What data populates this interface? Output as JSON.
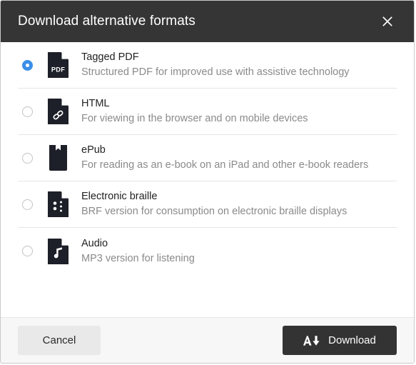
{
  "dialog": {
    "title": "Download alternative formats",
    "close_icon": "close-icon"
  },
  "formats": [
    {
      "id": "tagged-pdf",
      "title": "Tagged PDF",
      "description": "Structured PDF for improved use with assistive technology",
      "icon": "pdf-file-icon",
      "icon_label": "PDF",
      "selected": true
    },
    {
      "id": "html",
      "title": "HTML",
      "description": "For viewing in the browser and on mobile devices",
      "icon": "html-link-file-icon",
      "selected": false
    },
    {
      "id": "epub",
      "title": "ePub",
      "description": "For reading as an e-book on an iPad and other e-book readers",
      "icon": "epub-book-icon",
      "selected": false
    },
    {
      "id": "electronic-braille",
      "title": "Electronic braille",
      "description": "BRF version for consumption on electronic braille displays",
      "icon": "braille-file-icon",
      "selected": false
    },
    {
      "id": "audio",
      "title": "Audio",
      "description": "MP3 version for listening",
      "icon": "audio-note-file-icon",
      "selected": false
    }
  ],
  "footer": {
    "cancel_label": "Cancel",
    "download_label": "Download",
    "download_icon": "accessible-download-icon"
  },
  "colors": {
    "header_bg": "#353535",
    "accent_selected": "#3b8fe8",
    "icon_dark": "#1d2028",
    "footer_bg": "#f7f7f7",
    "download_btn_bg": "#333333",
    "cancel_btn_bg": "#e9e9e9"
  }
}
